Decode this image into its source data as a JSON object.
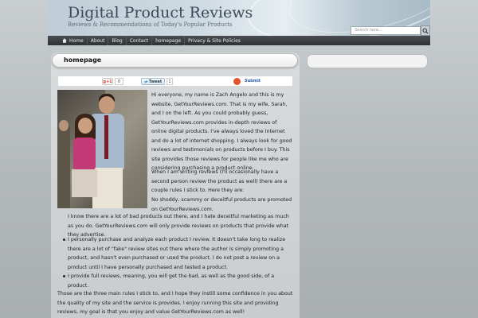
{
  "header": {
    "site_title": "Digital Product Reviews",
    "tagline": "Reviews & Recommendations of Today's Popular Products",
    "search_placeholder": "Search here..."
  },
  "nav": {
    "items": [
      "Home",
      "About",
      "Blog",
      "Contact",
      "homepage",
      "Privacy & Site Policies"
    ]
  },
  "page": {
    "title": "homepage"
  },
  "share": {
    "gplus_label": "g+1",
    "gplus_count": "0",
    "tweet_label": "Tweet",
    "tweet_count": "1",
    "submit_label": "Submit"
  },
  "article": {
    "intro": "Hi everyone, my name is Zach Angelo and this is my website, GetYourReviews.com.  That is my wife, Sarah, and I on the left.  As you could probably guess, GetYourReviews.com provides in-depth reviews of online digital products.  I've always loved the Internet and do a lot of internet shopping.  I always look for good reviews and testimonials on products before I buy.  This site provides those reviews for people like me who are considering purchasing a product online.",
    "rules_intro": "When I am writing reviews (I'll occasionally have a second person review the product as well) there are a couple rules I stick to.  Here they are:",
    "rule1_start": "No shoddy, scammy or deceitful products are promoted on GetYourReviews.com.",
    "rule1_rest": "I know there are a lot of bad products out there, and I hate deceitful marketing as much as you do.  GetYourReviews.com will only provide reviews on products that provide what they advertise.",
    "bullets": [
      "I personally purchase and analyze each product I review.  It doesn't take long to realize there are a lot of \"fake\" review sites out there where the author is simply promoting a product, and hasn't even purchased or used the product.  I do not post a review on a product until I have personally purchased and tested a product.",
      "I provide full reviews, meaning, you will get the bad, as well as the good side, of a product."
    ],
    "closing": "Those are the three main rules I stick to, and I hope they instill some confidence in you about the quality of my site and the service is provides.  I enjoy running this site and providing reviews, my goal is that you enjoy and value GetYourReviews.com as well!"
  },
  "colors": {
    "nav_bg": "#2f3235",
    "submit_link": "#2a5cab",
    "gplus_red": "#d73d32"
  },
  "icons": {
    "home": "home-icon",
    "search": "search-icon",
    "stumbleupon": "stumbleupon-icon",
    "twitter": "twitter-bird-icon"
  }
}
